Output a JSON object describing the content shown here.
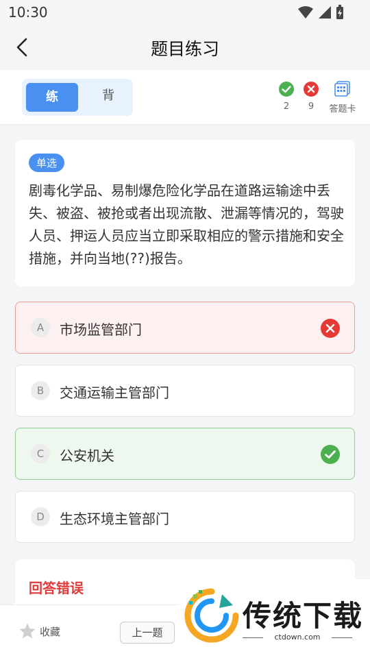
{
  "status": {
    "time": "10:30"
  },
  "nav": {
    "title": "题目练习"
  },
  "mode": {
    "practice": "练",
    "memorize": "背"
  },
  "stats": {
    "right_count": "2",
    "wrong_count": "9",
    "card_label": "答题卡"
  },
  "question": {
    "type": "单选",
    "text": "剧毒化学品、易制爆危险化学品在道路运输途中丢失、被盗、被抢或者出现流散、泄漏等情况的，驾驶人员、押运人员应当立即采取相应的警示措施和安全措施，并向当地(??)报告。"
  },
  "options": [
    {
      "letter": "A",
      "text": "市场监管部门",
      "state": "wrong"
    },
    {
      "letter": "B",
      "text": "交通运输主管部门",
      "state": "normal"
    },
    {
      "letter": "C",
      "text": "公安机关",
      "state": "correct"
    },
    {
      "letter": "D",
      "text": "生态环境主管部门",
      "state": "normal"
    }
  ],
  "result": {
    "title": "回答错误"
  },
  "bottom": {
    "favorite": "收藏",
    "prev": "上一题"
  },
  "watermark": {
    "brand": "传统下载",
    "url": "ctdown.com"
  },
  "colors": {
    "accent": "#4a90f0",
    "wrong": "#e03a3a",
    "correct": "#4caf50"
  }
}
